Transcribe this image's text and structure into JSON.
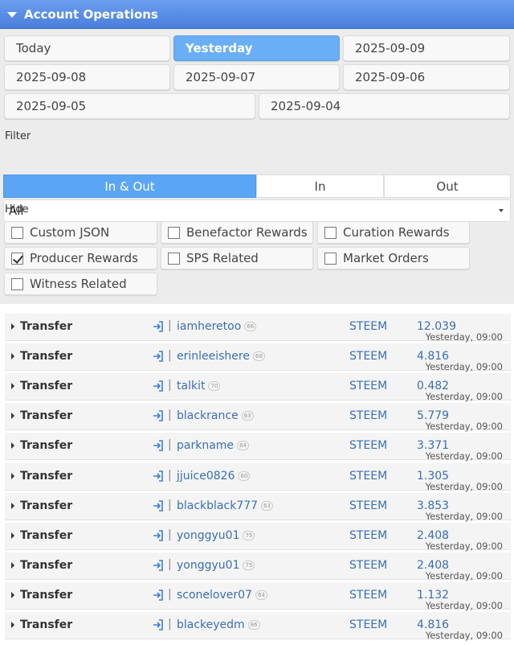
{
  "header": {
    "title": "Account Operations"
  },
  "dates": [
    "Today",
    "Yesterday",
    "2025-09-09",
    "2025-09-08",
    "2025-09-07",
    "2025-09-06",
    "2025-09-05",
    "2025-09-04"
  ],
  "active_date": "Yesterday",
  "filter": {
    "label": "Filter",
    "segments": [
      "In & Out",
      "In",
      "Out"
    ],
    "active": "In & Out",
    "select_value": "All"
  },
  "hide": {
    "label": "Hide",
    "options": [
      {
        "label": "Custom JSON",
        "checked": false
      },
      {
        "label": "Benefactor Rewards",
        "checked": false
      },
      {
        "label": "Curation Rewards",
        "checked": false
      },
      {
        "label": "Producer Rewards",
        "checked": true
      },
      {
        "label": "SPS Related",
        "checked": false
      },
      {
        "label": "Market Orders",
        "checked": false
      },
      {
        "label": "Witness Related",
        "checked": false
      }
    ]
  },
  "colors": {
    "header": "#4a7fdc",
    "active": "#6aaef5",
    "link": "#3a6fb0"
  },
  "operations": [
    {
      "type": "Transfer",
      "user": "iamheretoo",
      "rep": "66",
      "asset": "STEEM",
      "amount": "12.039",
      "time": "Yesterday, 09:00"
    },
    {
      "type": "Transfer",
      "user": "erinleeishere",
      "rep": "68",
      "asset": "STEEM",
      "amount": "4.816",
      "time": "Yesterday, 09:00"
    },
    {
      "type": "Transfer",
      "user": "talkit",
      "rep": "70",
      "asset": "STEEM",
      "amount": "0.482",
      "time": "Yesterday, 09:00"
    },
    {
      "type": "Transfer",
      "user": "blackrance",
      "rep": "63",
      "asset": "STEEM",
      "amount": "5.779",
      "time": "Yesterday, 09:00"
    },
    {
      "type": "Transfer",
      "user": "parkname",
      "rep": "84",
      "asset": "STEEM",
      "amount": "3.371",
      "time": "Yesterday, 09:00"
    },
    {
      "type": "Transfer",
      "user": "jjuice0826",
      "rep": "60",
      "asset": "STEEM",
      "amount": "1.305",
      "time": "Yesterday, 09:00"
    },
    {
      "type": "Transfer",
      "user": "blackblack777",
      "rep": "63",
      "asset": "STEEM",
      "amount": "3.853",
      "time": "Yesterday, 09:00"
    },
    {
      "type": "Transfer",
      "user": "yonggyu01",
      "rep": "75",
      "asset": "STEEM",
      "amount": "2.408",
      "time": "Yesterday, 09:00"
    },
    {
      "type": "Transfer",
      "user": "yonggyu01",
      "rep": "75",
      "asset": "STEEM",
      "amount": "2.408",
      "time": "Yesterday, 09:00"
    },
    {
      "type": "Transfer",
      "user": "sconelover07",
      "rep": "64",
      "asset": "STEEM",
      "amount": "1.132",
      "time": "Yesterday, 09:00"
    },
    {
      "type": "Transfer",
      "user": "blackeyedm",
      "rep": "86",
      "asset": "STEEM",
      "amount": "4.816",
      "time": "Yesterday, 09:00"
    }
  ]
}
